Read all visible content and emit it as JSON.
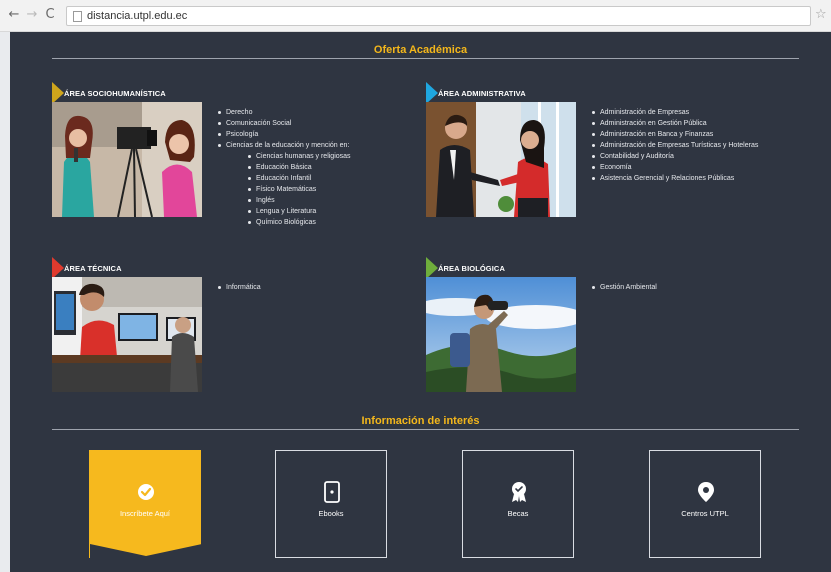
{
  "browser": {
    "url": "distancia.utpl.edu.ec",
    "back_glyph": "←",
    "forward_glyph": "→",
    "reload_glyph": "C",
    "star_glyph": "☆"
  },
  "oferta": {
    "title": "Oferta Académica",
    "areas": [
      {
        "title": "ÁREA SOCIOHUMANÍSTICA",
        "color": "#cfa51c",
        "items": [
          {
            "text": "Derecho",
            "sub": false
          },
          {
            "text": "Comunicación Social",
            "sub": false
          },
          {
            "text": "Psicología",
            "sub": false
          },
          {
            "text": "Ciencias de la educación y mención en:",
            "sub": false
          },
          {
            "text": "Ciencias humanas y religiosas",
            "sub": true
          },
          {
            "text": "Educación Básica",
            "sub": true
          },
          {
            "text": "Educación Infantil",
            "sub": true
          },
          {
            "text": "Físico Matemáticas",
            "sub": true
          },
          {
            "text": "Inglés",
            "sub": true
          },
          {
            "text": "Lengua y Literatura",
            "sub": true
          },
          {
            "text": "Químico Biológicas",
            "sub": true
          }
        ]
      },
      {
        "title": "ÁREA ADMINISTRATIVA",
        "color": "#1fa7e0",
        "items": [
          {
            "text": "Administración de Empresas",
            "sub": false
          },
          {
            "text": "Administración en Gestión Pública",
            "sub": false
          },
          {
            "text": "Administración en Banca y Finanzas",
            "sub": false
          },
          {
            "text": "Administración de Empresas Turísticas y Hoteleras",
            "sub": false
          },
          {
            "text": "Contabilidad y Auditoría",
            "sub": false
          },
          {
            "text": "Economía",
            "sub": false
          },
          {
            "text": "Asistencia Gerencial y Relaciones Públicas",
            "sub": false
          }
        ]
      },
      {
        "title": "ÁREA TÉCNICA",
        "color": "#e03a2e",
        "items": [
          {
            "text": "Informática",
            "sub": false
          }
        ]
      },
      {
        "title": "ÁREA BIOLÓGICA",
        "color": "#6fae3c",
        "items": [
          {
            "text": "Gestión Ambiental",
            "sub": false
          }
        ]
      }
    ]
  },
  "info": {
    "title": "Información de interés",
    "cards": [
      {
        "label": "Inscríbete Aquí",
        "icon": "check-badge-icon",
        "active": true
      },
      {
        "label": "Ebooks",
        "icon": "tablet-icon",
        "active": false
      },
      {
        "label": "Becas",
        "icon": "award-icon",
        "active": false
      },
      {
        "label": "Centros UTPL",
        "icon": "location-pin-icon",
        "active": false
      }
    ],
    "active_color": "#f6b91e"
  }
}
